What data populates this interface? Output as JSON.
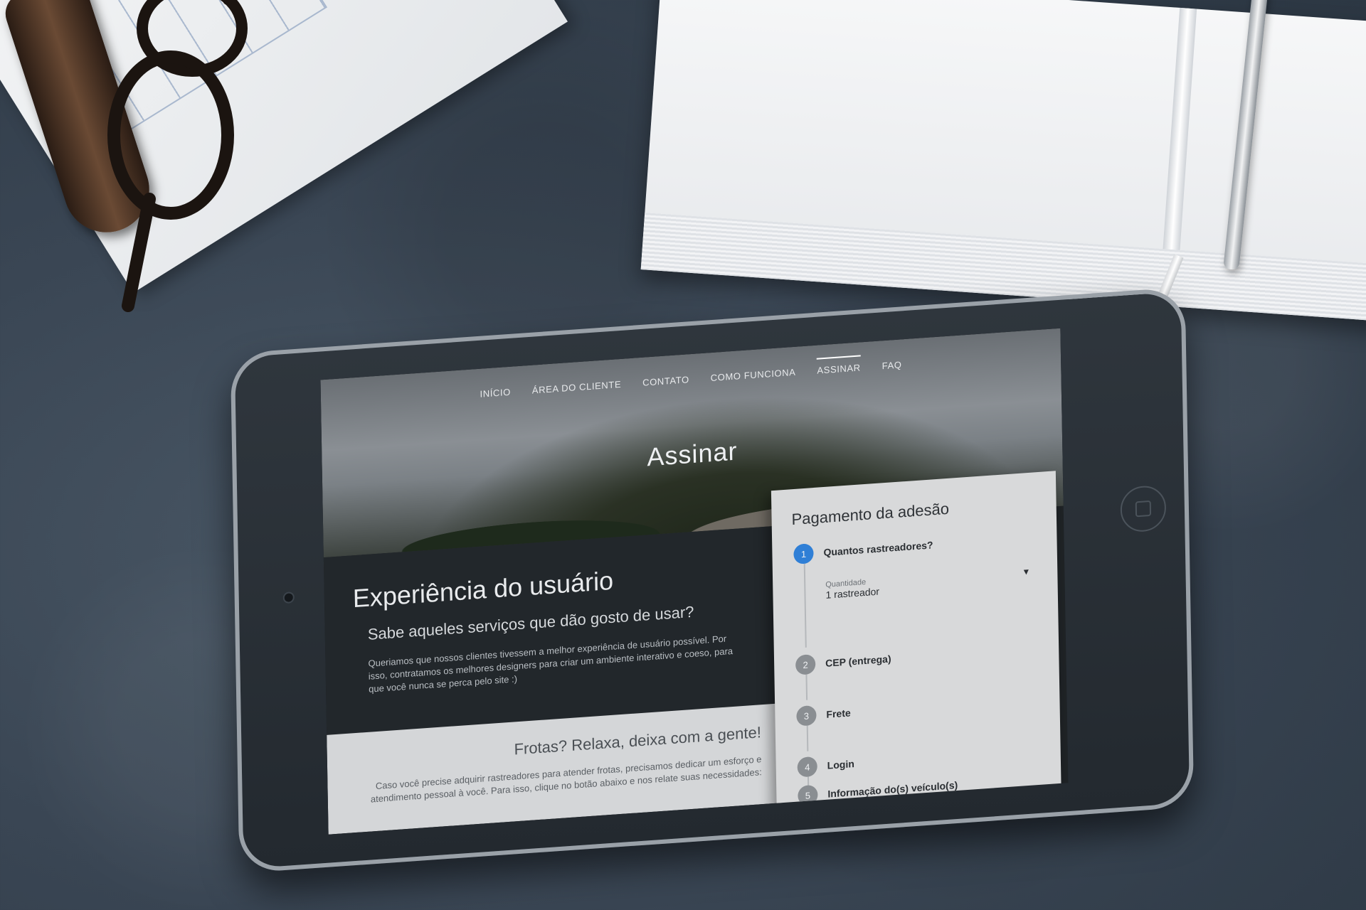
{
  "nav": {
    "items": [
      {
        "label": "INÍCIO"
      },
      {
        "label": "ÁREA DO CLIENTE"
      },
      {
        "label": "CONTATO"
      },
      {
        "label": "COMO FUNCIONA"
      },
      {
        "label": "ASSINAR"
      },
      {
        "label": "FAQ"
      }
    ],
    "active": "ASSINAR"
  },
  "hero": {
    "title": "Assinar"
  },
  "ux": {
    "title": "Experiência do usuário",
    "subtitle": "Sabe aqueles serviços que dão gosto de usar?",
    "text": "Queriamos que nossos clientes tivessem a melhor experiência de usuário possível. Por isso, contratamos os melhores designers para criar um ambiente interativo e coeso, para que você nunca se perca pelo site :)"
  },
  "fleet": {
    "title": "Frotas? Relaxa, deixa com a gente!",
    "text": "Caso você precise adquirir rastreadores para atender frotas, precisamos dedicar um esforço e atendimento pessoal à você. Para isso, clique no botão abaixo e nos relate suas necessidades:"
  },
  "payment": {
    "title": "Pagamento da adesão",
    "steps": [
      {
        "num": "1",
        "label": "Quantos rastreadores?"
      },
      {
        "num": "2",
        "label": "CEP (entrega)"
      },
      {
        "num": "3",
        "label": "Frete"
      },
      {
        "num": "4",
        "label": "Login"
      },
      {
        "num": "5",
        "label": "Informação do(s) veículo(s)"
      }
    ],
    "quantity": {
      "caption": "Quantidade",
      "value": "1 rastreador",
      "arrow": "▼"
    }
  },
  "colors": {
    "accent": "#2f7fd6",
    "dark_panel": "#22272b",
    "light_panel": "#d4d6d8"
  }
}
